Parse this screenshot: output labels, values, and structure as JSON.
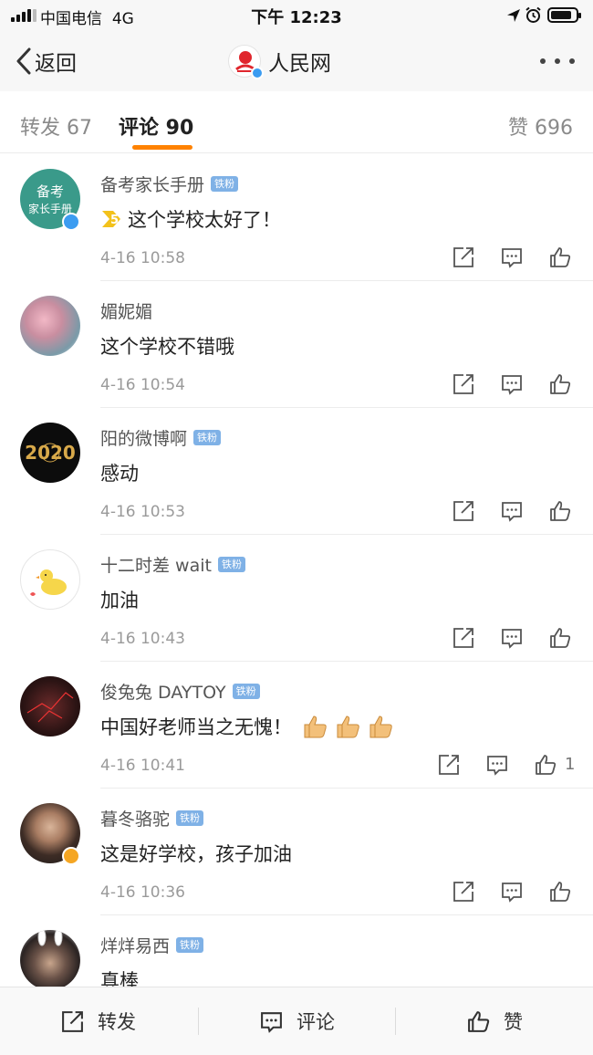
{
  "status_bar": {
    "carrier": "中国电信",
    "network": "4G",
    "time": "下午 12:23",
    "battery_level": 0.85
  },
  "nav": {
    "back_label": "返回",
    "title": "人民网",
    "logo_icon": "people-daily-logo-icon",
    "more_icon": "more-dots-icon"
  },
  "tabs": {
    "repost": "转发 67",
    "comments": "评论 90",
    "likes": "赞 696"
  },
  "comments": [
    {
      "user": "备考家长手册",
      "badge": "铁粉",
      "text": "这个学校太好了！",
      "prefix_icon": "rank-5-icon",
      "time": "4-16 10:58",
      "likes": "",
      "avatar_text": "备考家长手册",
      "verified": "blue"
    },
    {
      "user": "媚妮媚",
      "badge": "",
      "text": "这个学校不错哦",
      "time": "4-16 10:54",
      "likes": ""
    },
    {
      "user": "阳的微博啊",
      "badge": "铁粉",
      "text": "感动",
      "time": "4-16 10:53",
      "likes": ""
    },
    {
      "user": "十二时差 wait",
      "badge": "铁粉",
      "text": "加油",
      "time": "4-16 10:43",
      "likes": ""
    },
    {
      "user": "俊兔兔 DAYTOY",
      "badge": "铁粉",
      "text": "中国好老师当之无愧！",
      "suffix_icons": [
        "thumbs-up-emoji-icon",
        "thumbs-up-emoji-icon",
        "thumbs-up-emoji-icon"
      ],
      "time": "4-16 10:41",
      "likes": "1"
    },
    {
      "user": "暮冬骆驼",
      "badge": "铁粉",
      "text": "这是好学校，孩子加油",
      "time": "4-16 10:36",
      "likes": "",
      "verified": "orange"
    },
    {
      "user": "烊烊易西",
      "badge": "铁粉",
      "text": "真棒",
      "time": "",
      "likes": ""
    }
  ],
  "bottom_bar": {
    "repost": "转发",
    "comment": "评论",
    "like": "赞"
  },
  "colors": {
    "accent": "#ff8200",
    "badge": "#7fb1e6",
    "verified_blue": "#3b9cf1",
    "verified_orange": "#f5a623"
  }
}
